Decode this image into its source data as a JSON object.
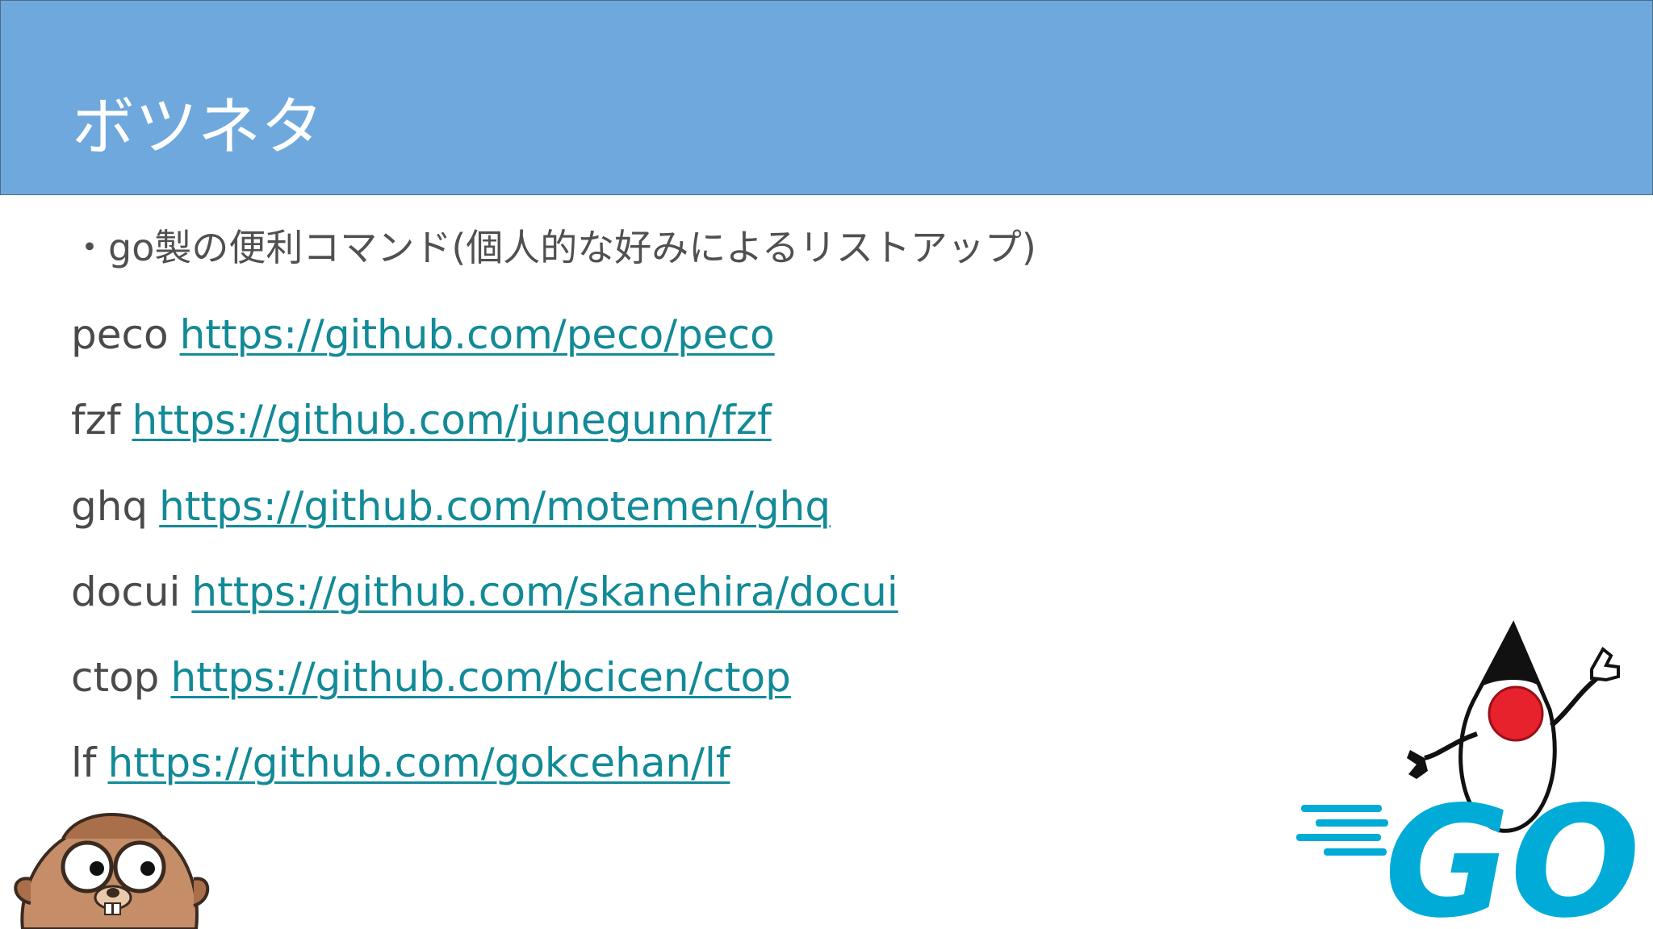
{
  "slide": {
    "title": "ボツネタ",
    "intro": "・go製の便利コマンド(個人的な好みによるリストアップ)"
  },
  "tools": [
    {
      "name": "peco",
      "url": "https://github.com/peco/peco"
    },
    {
      "name": "fzf",
      "url": "https://github.com/junegunn/fzf"
    },
    {
      "name": "ghq",
      "url": "https://github.com/motemen/ghq"
    },
    {
      "name": "docui",
      "url": "https://github.com/skanehira/docui"
    },
    {
      "name": "ctop",
      "url": "https://github.com/bcicen/ctop"
    },
    {
      "name": "lf",
      "url": "https://github.com/gokcehan/lf"
    }
  ],
  "logos": {
    "go_logo_text": "GO"
  },
  "colors": {
    "header": "#6fa8dc",
    "link": "#128a97",
    "go_blue": "#00acd7",
    "duke_nose": "#e8222d"
  }
}
